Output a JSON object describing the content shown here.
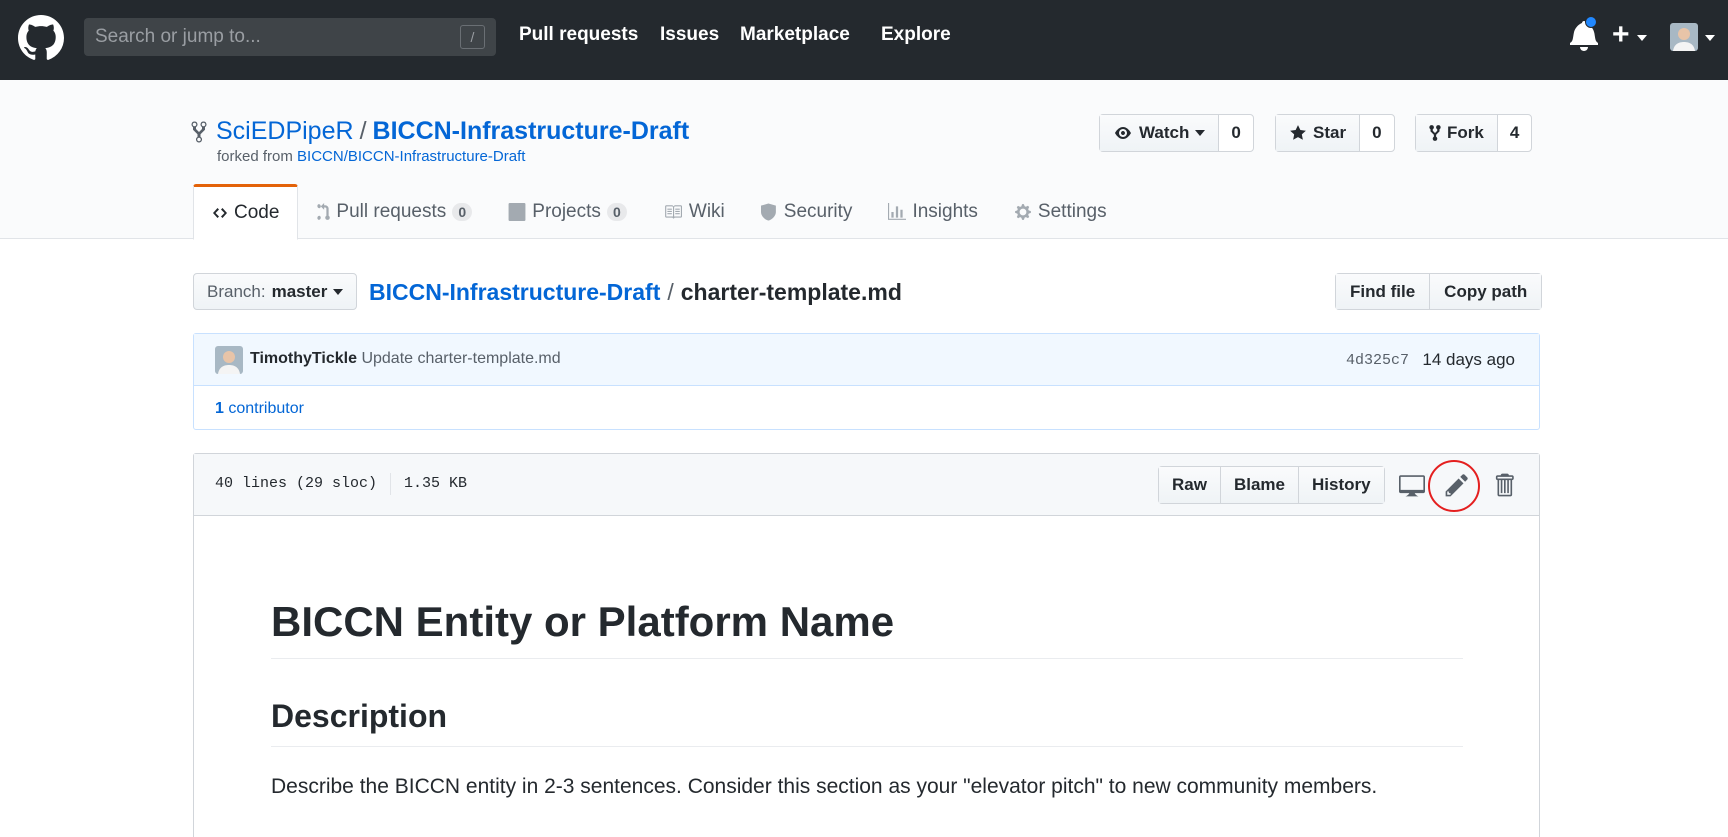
{
  "header": {
    "search_placeholder": "Search or jump to...",
    "search_shortcut": "/",
    "nav": [
      "Pull requests",
      "Issues",
      "Marketplace",
      "Explore"
    ],
    "plus_label": "+"
  },
  "repo": {
    "owner": "SciEDPipeR",
    "separator": "/",
    "name": "BICCN-Infrastructure-Draft",
    "forked_prefix": "forked from",
    "forked_from": "BICCN/BICCN-Infrastructure-Draft",
    "watch_label": "Watch",
    "watch_count": "0",
    "star_label": "Star",
    "star_count": "0",
    "fork_label": "Fork",
    "fork_count": "4"
  },
  "tabs": [
    {
      "label": "Code"
    },
    {
      "label": "Pull requests",
      "counter": "0"
    },
    {
      "label": "Projects",
      "counter": "0"
    },
    {
      "label": "Wiki"
    },
    {
      "label": "Security"
    },
    {
      "label": "Insights"
    },
    {
      "label": "Settings"
    }
  ],
  "filenav": {
    "branch_prefix": "Branch:",
    "branch": "master",
    "root": "BICCN-Infrastructure-Draft",
    "separator": "/",
    "file": "charter-template.md",
    "find_file": "Find file",
    "copy_path": "Copy path"
  },
  "commit": {
    "author": "TimothyTickle",
    "message": "Update charter-template.md",
    "sha": "4d325c7",
    "age": "14 days ago",
    "contributor_count": "1",
    "contributor_label": "contributor"
  },
  "file": {
    "lines": "40 lines (29 sloc)",
    "size": "1.35 KB",
    "raw": "Raw",
    "blame": "Blame",
    "history": "History"
  },
  "markdown": {
    "h1": "BICCN Entity or Platform Name",
    "h2": "Description",
    "p": "Describe the BICCN entity in 2-3 sentences. Consider this section as your \"elevator pitch\" to new community members."
  },
  "colors": {
    "header_bg": "#24292e",
    "link": "#0366d6",
    "tab_accent": "#e36209",
    "highlight_ring": "#e41f1f",
    "notification_dot": "#2188ff"
  },
  "icons": [
    "github-logo-icon",
    "bell-icon",
    "plus-icon",
    "avatar",
    "repo-forked-icon",
    "eye-icon",
    "star-icon",
    "code-icon",
    "git-pull-request-icon",
    "project-icon",
    "book-icon",
    "shield-icon",
    "graph-icon",
    "gear-icon",
    "device-desktop-icon",
    "pencil-icon",
    "trashcan-icon"
  ]
}
